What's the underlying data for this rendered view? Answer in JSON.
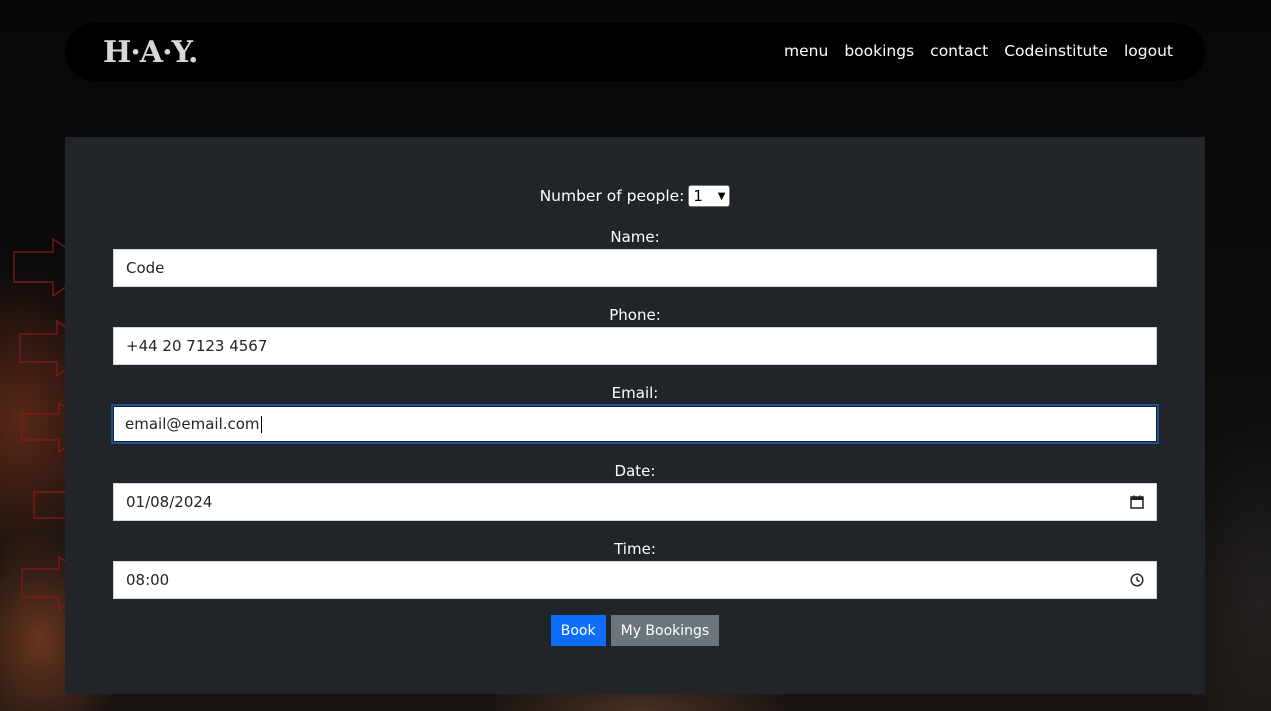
{
  "brand": {
    "logo_text": "H·A·Y."
  },
  "nav": {
    "links": [
      "menu",
      "bookings",
      "contact",
      "Codeinstitute",
      "logout"
    ]
  },
  "form": {
    "people_label": "Number of people:",
    "people_value": "1",
    "name_label": "Name:",
    "name_value": "Code",
    "phone_label": "Phone:",
    "phone_value": "+44 20 7123 4567",
    "email_label": "Email:",
    "email_value": "email@email.com",
    "date_label": "Date:",
    "date_value": "01/08/2024",
    "time_label": "Time:",
    "time_value": "08:00"
  },
  "buttons": {
    "book": "Book",
    "my_bookings": "My Bookings"
  },
  "colors": {
    "panel": "#212529",
    "primary": "#0d6efd",
    "secondary": "#6c757d",
    "annotation_arrow": "#8b1a1a"
  }
}
